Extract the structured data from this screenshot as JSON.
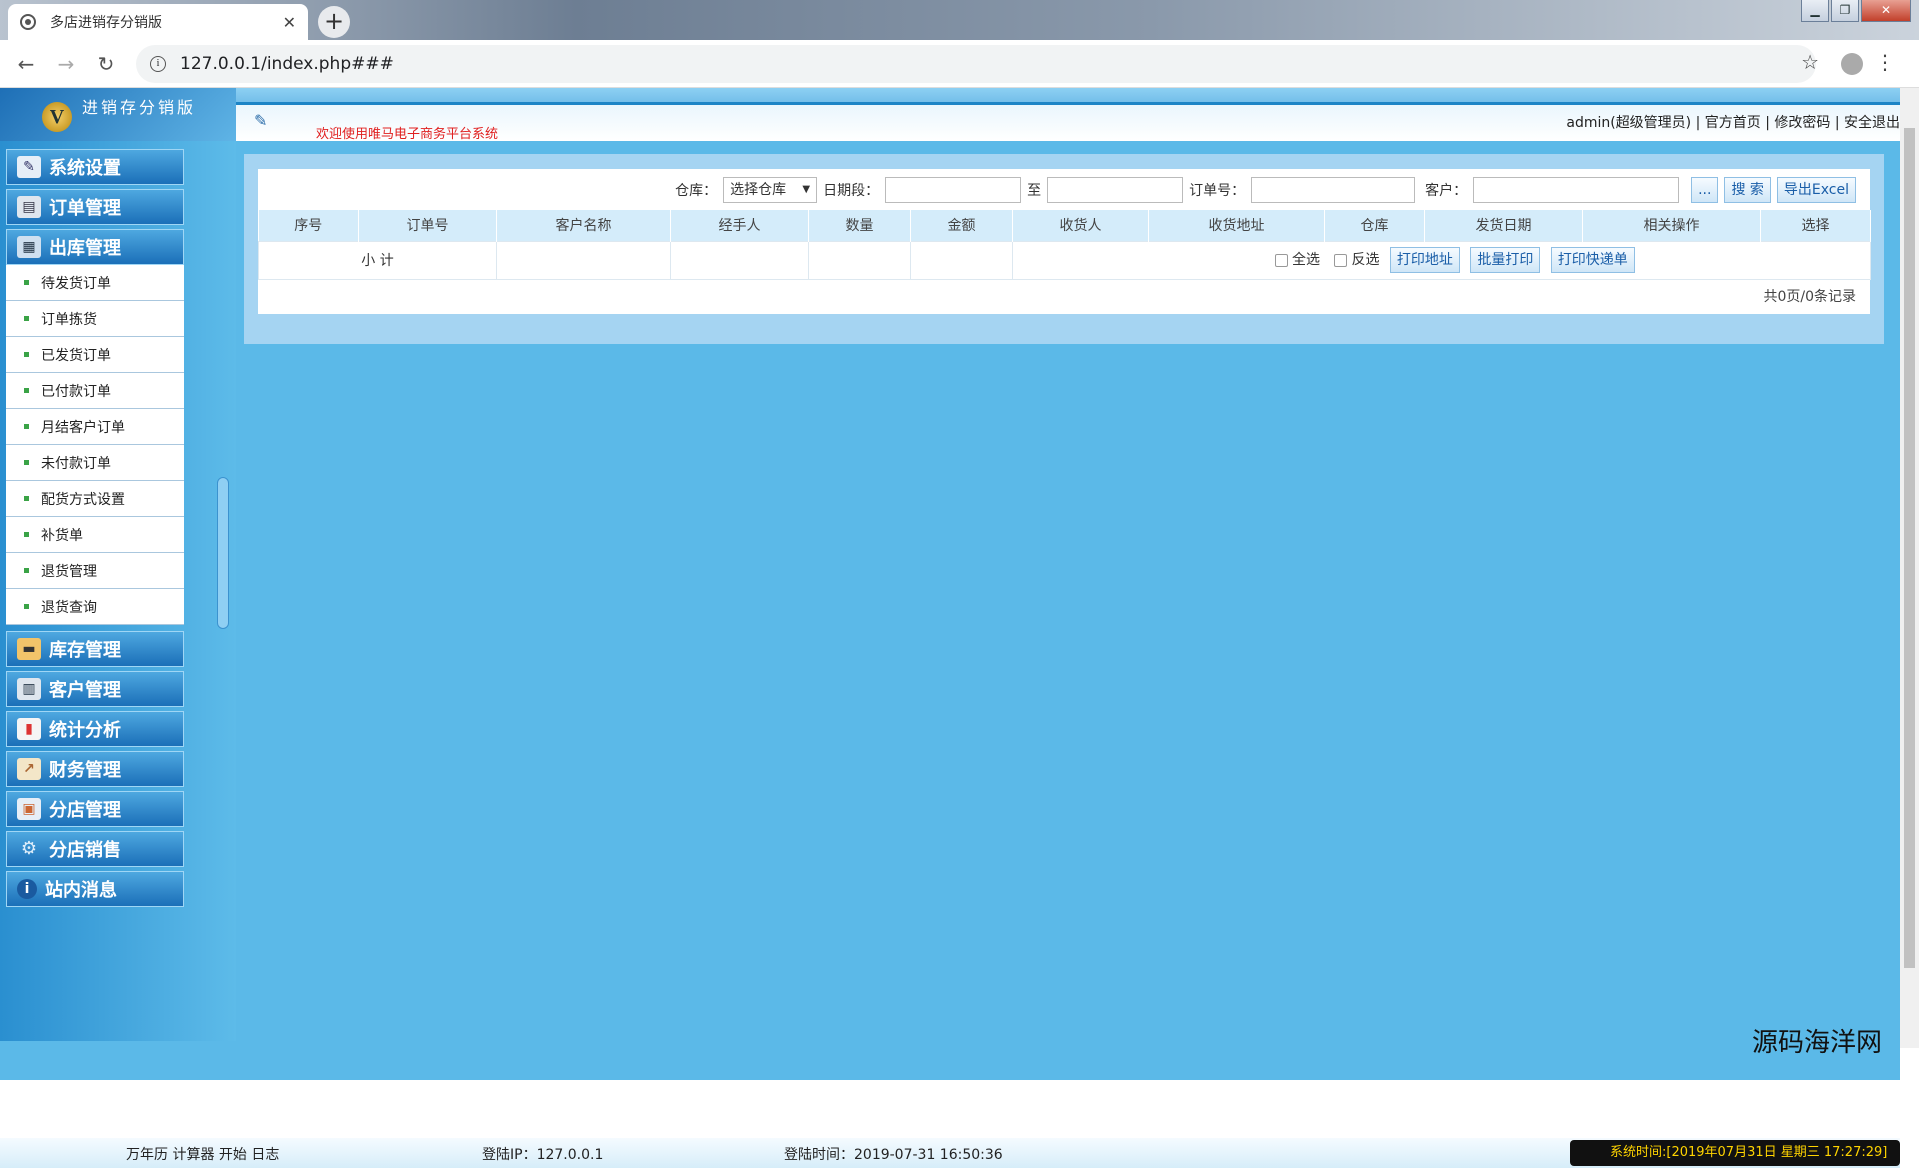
{
  "browser": {
    "tab_title": "多店进销存分销版",
    "url": "127.0.0.1/index.php###"
  },
  "header": {
    "logo_letter": "V",
    "logo_text": "进销存分销版",
    "welcome": "欢迎使用唯马电子商务平台系统",
    "links": "admin(超级管理员) | 官方首页 | 修改密码 | 安全退出"
  },
  "sidebar": {
    "sections": [
      {
        "label": "系统设置",
        "icon": "wrench-icon"
      },
      {
        "label": "订单管理",
        "icon": "monitor-icon"
      },
      {
        "label": "出库管理",
        "icon": "cart-icon"
      }
    ],
    "subitems": [
      "待发货订单",
      "订单拣货",
      "已发货订单",
      "已付款订单",
      "月结客户订单",
      "未付款订单",
      "配货方式设置",
      "补货单",
      "退货管理",
      "退货查询"
    ],
    "sections_after": [
      {
        "label": "库存管理",
        "icon": "truck-icon"
      },
      {
        "label": "客户管理",
        "icon": "customer-icon"
      },
      {
        "label": "统计分析",
        "icon": "chart-icon"
      },
      {
        "label": "财务管理",
        "icon": "finance-icon"
      },
      {
        "label": "分店管理",
        "icon": "store-icon"
      },
      {
        "label": "分店销售",
        "icon": "gear-icon"
      },
      {
        "label": "站内消息",
        "icon": "info-icon"
      }
    ]
  },
  "search": {
    "warehouse_label": "仓库：",
    "warehouse_value": "选择仓库",
    "date_label": "日期段：",
    "date_to": "至",
    "order_label": "订单号：",
    "customer_label": "客户：",
    "dots_btn": "...",
    "search_btn": "搜 索",
    "export_btn": "导出Excel"
  },
  "table": {
    "columns": [
      "序号",
      "订单号",
      "客户名称",
      "经手人",
      "数量",
      "金额",
      "收货人",
      "收货地址",
      "仓库",
      "发货日期",
      "相关操作",
      "选择"
    ],
    "subtotal": "小 计",
    "select_all": "全选",
    "invert": "反选",
    "print_addr": "打印地址",
    "batch_print": "批量打印",
    "print_express": "打印快递单",
    "pager": "共0页/0条记录"
  },
  "footer": {
    "tools": "万年历  计算器  开始  日志",
    "login_ip": "登陆IP：127.0.0.1",
    "login_time": "登陆时间：2019-07-31 16:50:36",
    "system_time": "系统时间:[2019年07月31日 星期三 17:27:29]"
  },
  "watermark": "源码海洋网"
}
